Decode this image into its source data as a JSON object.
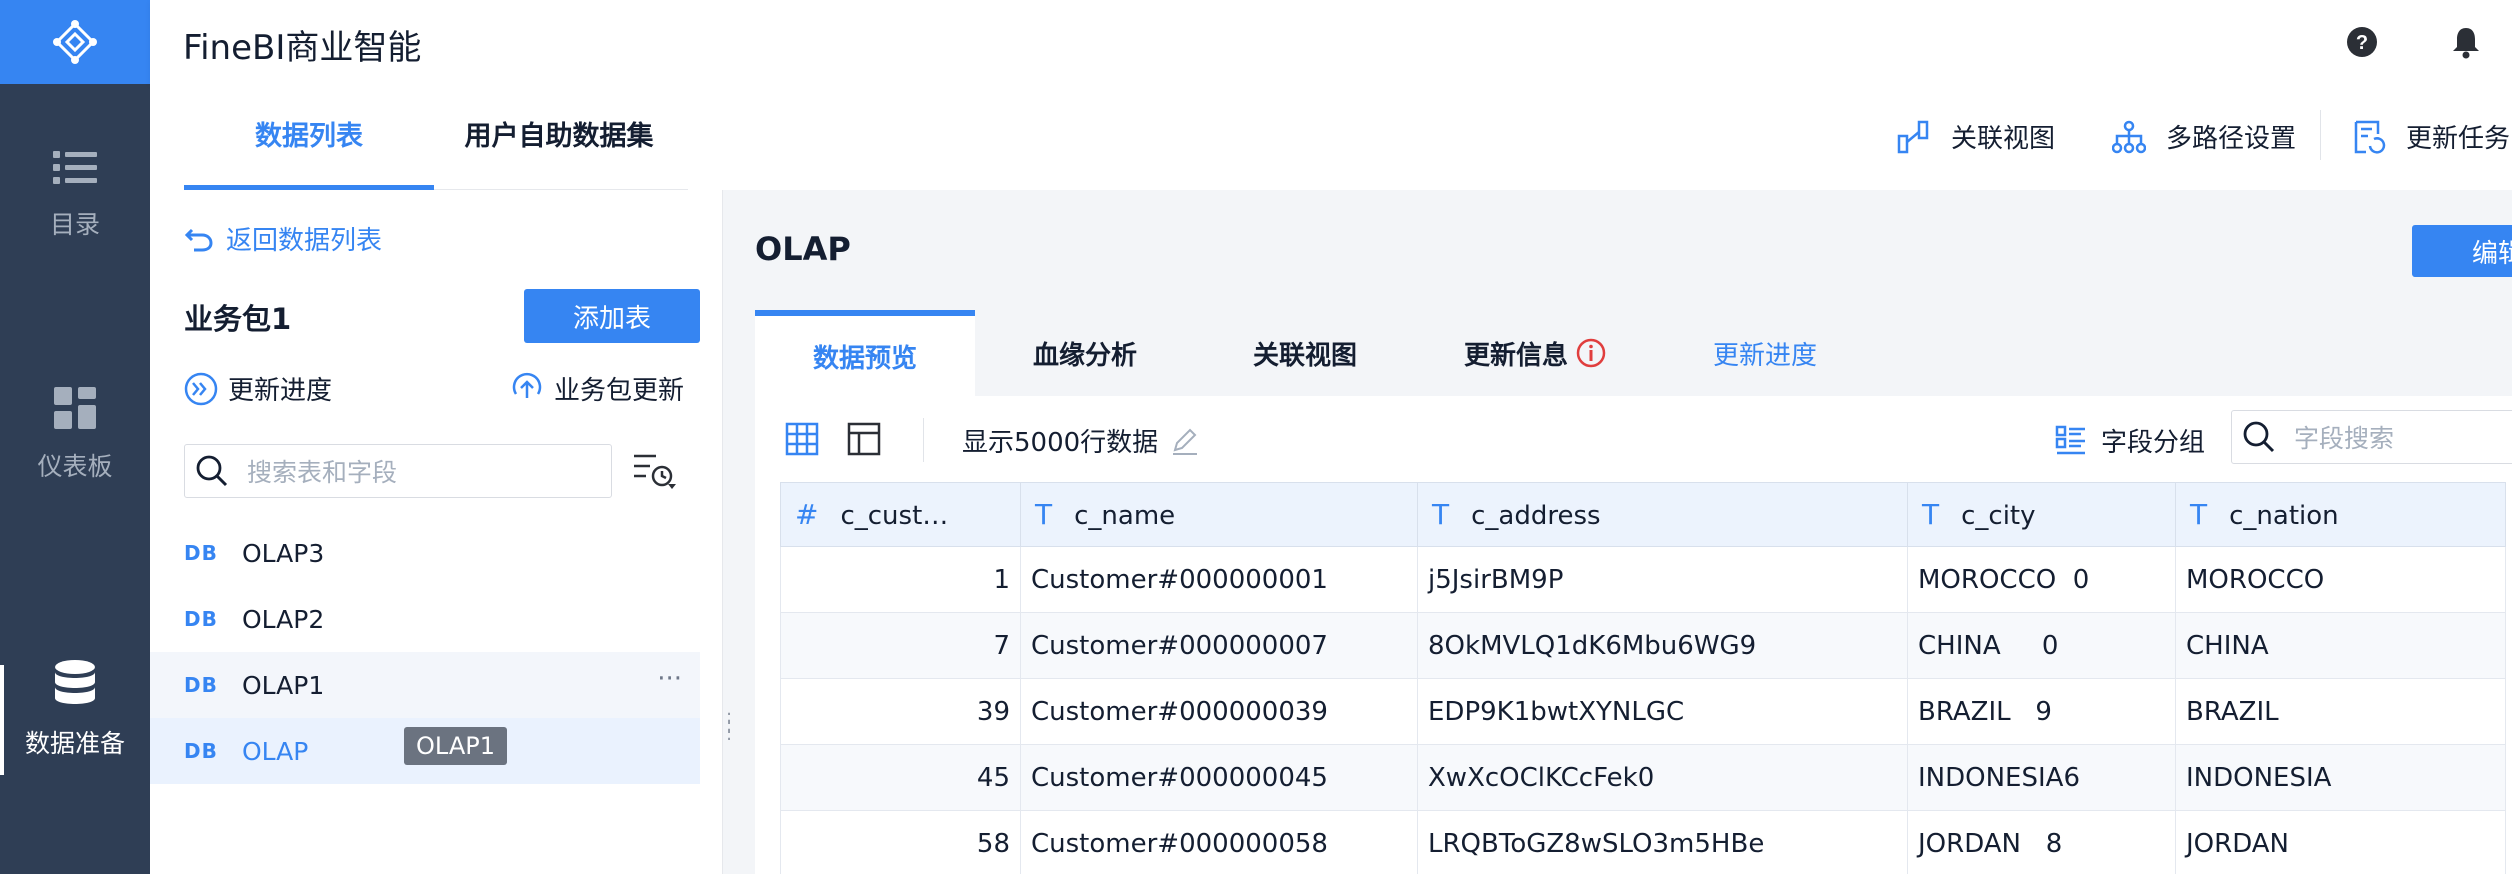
{
  "app": {
    "title": "FineBI商业智能"
  },
  "nav": [
    {
      "label": "目录",
      "icon": "list-icon"
    },
    {
      "label": "仪表板",
      "icon": "dashboard-icon"
    },
    {
      "label": "数据准备",
      "icon": "database-icon",
      "active": true
    }
  ],
  "left": {
    "tabs": [
      "数据列表",
      "用户自助数据集"
    ],
    "back_label": "返回数据列表",
    "package_title": "业务包1",
    "add_table_label": "添加表",
    "update_progress_label": "更新进度",
    "package_update_label": "业务包更新",
    "search_placeholder": "搜索表和字段",
    "tables": [
      {
        "badge": "DB",
        "name": "OLAP3"
      },
      {
        "badge": "DB",
        "name": "OLAP2"
      },
      {
        "badge": "DB",
        "name": "OLAP1"
      },
      {
        "badge": "DB",
        "name": "OLAP"
      }
    ],
    "more_label": "···",
    "tooltip": "OLAP1"
  },
  "toolbar_right": {
    "relation_view": "关联视图",
    "multipath": "多路径设置",
    "update_task": "更新任务"
  },
  "main": {
    "title": "OLAP",
    "edit_label": "编辑",
    "tabs": [
      "数据预览",
      "血缘分析",
      "关联视图",
      "更新信息",
      "更新进度"
    ],
    "rows_label": "显示5000行数据",
    "field_group_label": "字段分组",
    "field_search_placeholder": "字段搜索",
    "columns": [
      {
        "type": "#",
        "name": "c_cust…"
      },
      {
        "type": "T",
        "name": "c_name"
      },
      {
        "type": "T",
        "name": "c_address"
      },
      {
        "type": "T",
        "name": "c_city"
      },
      {
        "type": "T",
        "name": "c_nation"
      }
    ],
    "rows": [
      [
        "1",
        "Customer#000000001",
        "j5JsirBM9P",
        "MOROCCO  0",
        "MOROCCO"
      ],
      [
        "7",
        "Customer#000000007",
        "8OkMVLQ1dK6Mbu6WG9",
        "CHINA     0",
        "CHINA"
      ],
      [
        "39",
        "Customer#000000039",
        "EDP9K1bwtXYNLGC",
        "BRAZIL   9",
        "BRAZIL"
      ],
      [
        "45",
        "Customer#000000045",
        "XwXcOClKCcFek0",
        "INDONESIA6",
        "INDONESIA"
      ],
      [
        "58",
        "Customer#000000058",
        "LRQBToGZ8wSLO3m5HBe",
        "JORDAN   8",
        "JORDAN"
      ]
    ]
  },
  "colors": {
    "accent": "#3685f2",
    "sidebar": "#2f3e55",
    "warning": "#e03e3e"
  }
}
